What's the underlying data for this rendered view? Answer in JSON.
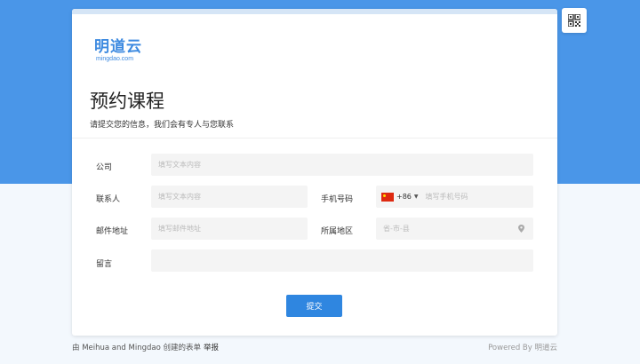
{
  "brand": {
    "name_cn": "明道云",
    "name_en": "mingdao.com",
    "color": "#3d8ae0"
  },
  "colors": {
    "banner": "#4a96e8",
    "submit": "#2f86e0"
  },
  "form": {
    "title": "预约课程",
    "subtitle": "请提交您的信息，我们会有专人与您联系",
    "fields": {
      "company": {
        "label": "公司",
        "placeholder": "填写文本内容"
      },
      "contact": {
        "label": "联系人",
        "placeholder": "填写文本内容"
      },
      "phone": {
        "label": "手机号码",
        "country_code": "+86",
        "placeholder": "填写手机号码"
      },
      "email": {
        "label": "邮件地址",
        "placeholder": "填写邮件地址"
      },
      "region": {
        "label": "所属地区",
        "placeholder": "省-市-县"
      },
      "message": {
        "label": "留言",
        "placeholder": ""
      }
    },
    "submit_label": "提交"
  },
  "icons": {
    "qr": "qr-code-icon",
    "flag": "china-flag-icon",
    "caret": "caret-down-icon",
    "pin": "location-pin-icon"
  },
  "footer": {
    "creator_text": "由 Meihua and Mingdao 创建的表单",
    "report_label": "举报",
    "powered_by": "Powered By 明道云"
  }
}
